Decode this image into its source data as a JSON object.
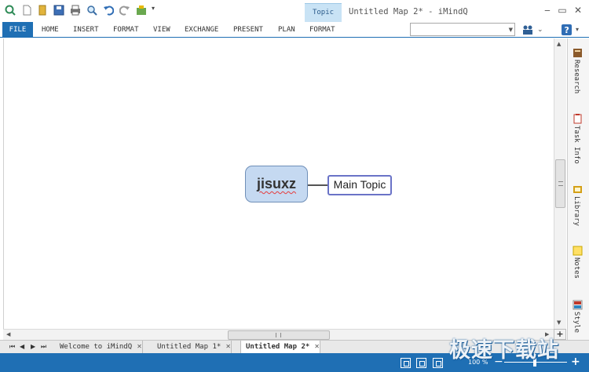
{
  "titlebar": {
    "context_tab": "Topic",
    "window_title": "Untitled Map 2* - iMindQ",
    "quick_access_icons": [
      "new-topic-icon",
      "new-document-icon",
      "open-folder-icon",
      "save-icon",
      "print-icon",
      "zoom-icon",
      "undo-icon",
      "redo-icon",
      "plugin-icon",
      "customize-dropdown-icon"
    ],
    "window_buttons": [
      "minimize",
      "restore",
      "close"
    ]
  },
  "ribbon": {
    "tabs": [
      "FILE",
      "HOME",
      "INSERT",
      "FORMAT",
      "VIEW",
      "EXCHANGE",
      "PRESENT",
      "PLAN",
      "FORMAT"
    ],
    "search_value": "",
    "right_icons": [
      "people-icon",
      "chevron-down-icon",
      "help-icon"
    ]
  },
  "map": {
    "central_topic": "jisuxz",
    "main_topic": "Main Topic",
    "central_fill": "#c5d9f1",
    "main_topic_border": "#6a73c7"
  },
  "side_panel": {
    "items": [
      {
        "label": "Research",
        "icon": "research-icon",
        "color": "#8b5a2b"
      },
      {
        "label": "Task Info",
        "icon": "task-info-icon",
        "color": "#c0392b"
      },
      {
        "label": "Library",
        "icon": "library-icon",
        "color": "#d4a017"
      },
      {
        "label": "Notes",
        "icon": "notes-icon",
        "color": "#e6b800"
      },
      {
        "label": "Style",
        "icon": "style-icon",
        "color": "#c0392b"
      }
    ]
  },
  "document_tabs": [
    {
      "label": "Welcome to iMindQ",
      "active": false
    },
    {
      "label": "Untitled Map 1*",
      "active": false
    },
    {
      "label": "Untitled Map 2*",
      "active": true
    }
  ],
  "statusbar": {
    "zoom_text": "100 %",
    "zoom_percent": 100,
    "accent": "#1f6fb4"
  },
  "watermark": "极速下载站"
}
